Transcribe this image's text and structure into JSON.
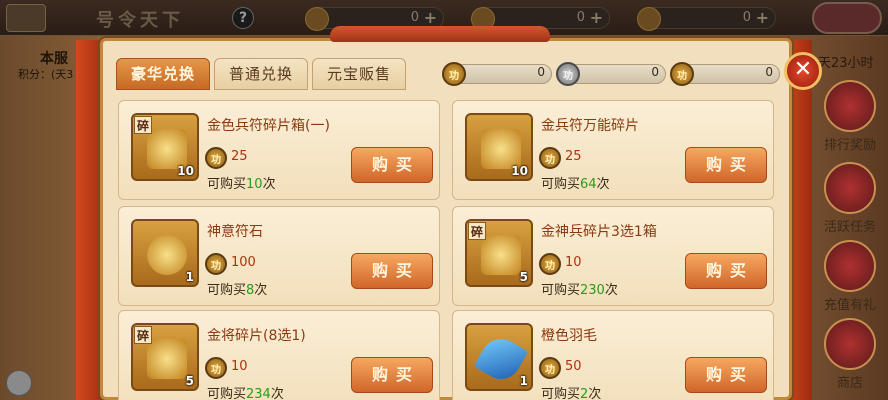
{
  "background": {
    "title": "号令天下",
    "resources": [
      {
        "value": "0"
      },
      {
        "value": "0"
      },
      {
        "value": "0"
      }
    ],
    "left_label": "本服",
    "left_sub": "积分：(天3",
    "right_top_text": "天23小时",
    "right_items": [
      {
        "label": "排行奖励"
      },
      {
        "label": "活跃任务"
      },
      {
        "label": "充值有礼"
      },
      {
        "label": "商店"
      }
    ]
  },
  "tabs": [
    {
      "label": "豪华兑换",
      "active": true
    },
    {
      "label": "普通兑换",
      "active": false
    },
    {
      "label": "元宝贩售",
      "active": false
    }
  ],
  "currencies": [
    {
      "icon": "gold-coin-icon",
      "glyph": "功",
      "value": "0"
    },
    {
      "icon": "silver-coin-icon",
      "glyph": "功",
      "value": "0"
    },
    {
      "icon": "gold-coin-icon",
      "glyph": "功",
      "value": "0"
    }
  ],
  "close_label": "✕",
  "limit_prefix": "可购买",
  "limit_suffix": "次",
  "buy_label": "购买",
  "items": [
    {
      "name": "金色兵符碎片箱(一)",
      "price": "25",
      "limit": "10",
      "qty": "10",
      "tag": "碎",
      "art": "chest"
    },
    {
      "name": "金兵符万能碎片",
      "price": "25",
      "limit": "64",
      "qty": "10",
      "tag": "",
      "art": "chest"
    },
    {
      "name": "神意符石",
      "price": "100",
      "limit": "8",
      "qty": "1",
      "tag": "",
      "art": "round"
    },
    {
      "name": "金神兵碎片3选1箱",
      "price": "10",
      "limit": "230",
      "qty": "5",
      "tag": "碎",
      "art": "chest"
    },
    {
      "name": "金将碎片(8选1)",
      "price": "10",
      "limit": "234",
      "qty": "5",
      "tag": "碎",
      "art": "chest"
    },
    {
      "name": "橙色羽毛",
      "price": "50",
      "limit": "2",
      "qty": "1",
      "tag": "",
      "art": "feather"
    }
  ]
}
